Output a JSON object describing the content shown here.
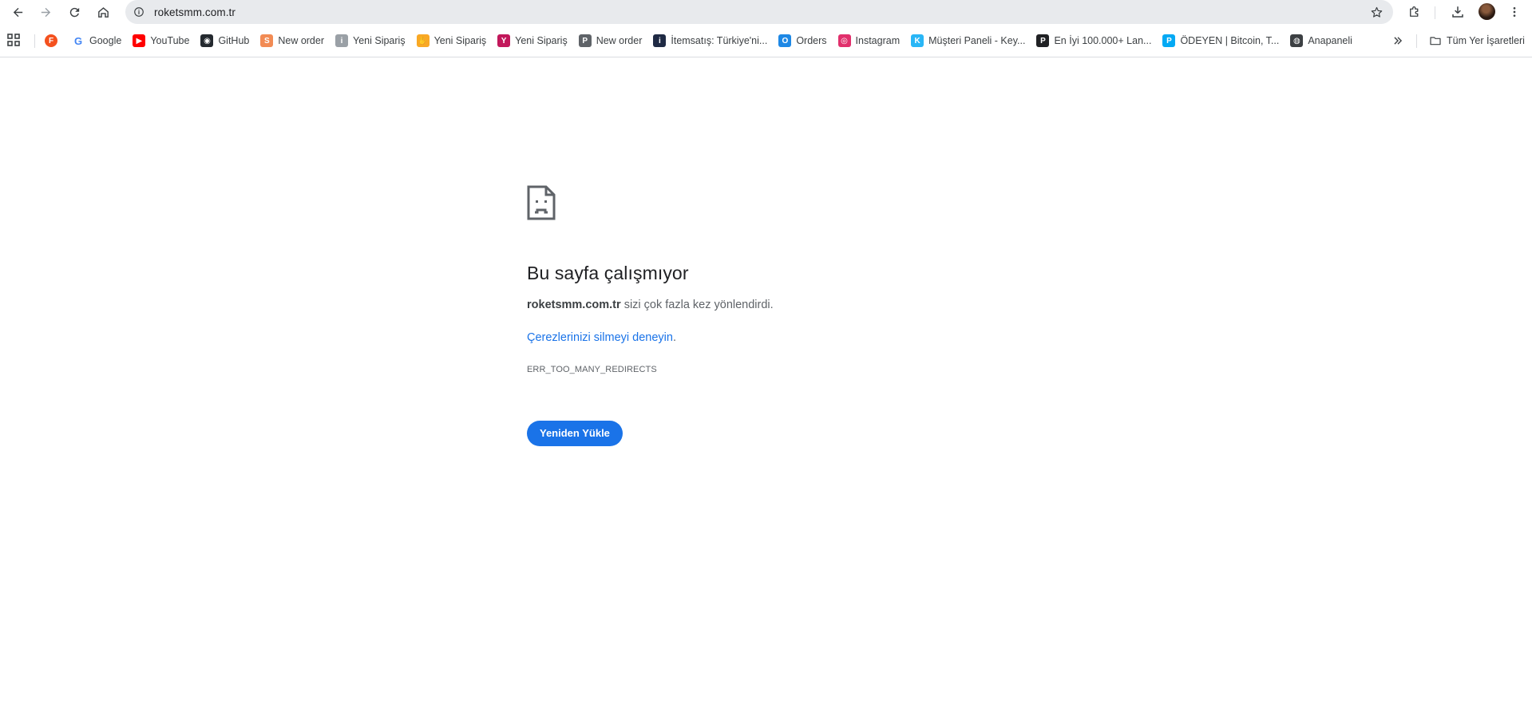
{
  "browser": {
    "url": "roketsmm.com.tr",
    "accent": "#1a73e8"
  },
  "bookmarks": {
    "items": [
      {
        "label": "",
        "icon": "f-logo-icon",
        "color": "#f4511e",
        "glyph": "F"
      },
      {
        "label": "Google",
        "icon": "google-icon",
        "color": "#ffffff",
        "glyph": "G"
      },
      {
        "label": "YouTube",
        "icon": "youtube-icon",
        "color": "#ff0000",
        "glyph": "▶"
      },
      {
        "label": "GitHub",
        "icon": "github-icon",
        "color": "#24292f",
        "glyph": "◉"
      },
      {
        "label": "New order",
        "icon": "smm-icon",
        "color": "#f28b54",
        "glyph": "S"
      },
      {
        "label": "Yeni Sipariş",
        "icon": "info-icon",
        "color": "#9aa0a6",
        "glyph": "i"
      },
      {
        "label": "Yeni Sipariş",
        "icon": "hand-icon",
        "color": "#f9a825",
        "glyph": "✋"
      },
      {
        "label": "Yeni Sipariş",
        "icon": "brand-icon",
        "color": "#c2185b",
        "glyph": "Y"
      },
      {
        "label": "New order",
        "icon": "p-icon",
        "color": "#5f6368",
        "glyph": "P"
      },
      {
        "label": "İtemsatış: Türkiye'ni...",
        "icon": "itemsatis-icon",
        "color": "#1f2a44",
        "glyph": "i"
      },
      {
        "label": "Orders",
        "icon": "orders-icon",
        "color": "#1e88e5",
        "glyph": "O"
      },
      {
        "label": "Instagram",
        "icon": "instagram-icon",
        "color": "#e1306c",
        "glyph": "◎"
      },
      {
        "label": "Müşteri Paneli - Key...",
        "icon": "k-icon",
        "color": "#29b6f6",
        "glyph": "K"
      },
      {
        "label": "En İyi 100.000+ Lan...",
        "icon": "dp-icon",
        "color": "#202124",
        "glyph": "P"
      },
      {
        "label": "ÖDEYEN | Bitcoin, T...",
        "icon": "odeyen-icon",
        "color": "#03a9f4",
        "glyph": "P"
      },
      {
        "label": "Anapaneli",
        "icon": "globe-icon",
        "color": "#3c4043",
        "glyph": "◍"
      }
    ],
    "all_bookmarks_label": "Tüm Yer İşaretleri"
  },
  "error": {
    "title": "Bu sayfa çalışmıyor",
    "host": "roketsmm.com.tr",
    "description": "sizi çok fazla kez yönlendirdi.",
    "suggestion_link": "Çerezlerinizi silmeyi deneyin",
    "suggestion_tail": ".",
    "code": "ERR_TOO_MANY_REDIRECTS",
    "reload_label": "Yeniden Yükle"
  }
}
